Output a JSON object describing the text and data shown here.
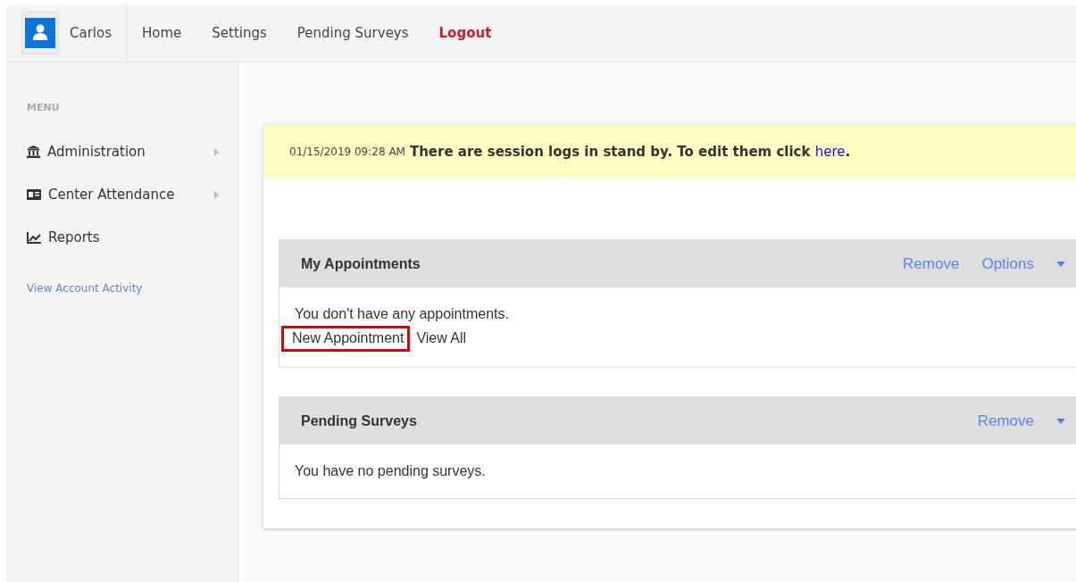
{
  "user": {
    "name": "Carlos"
  },
  "nav": [
    {
      "label": "Home",
      "kind": "link"
    },
    {
      "label": "Settings",
      "kind": "link"
    },
    {
      "label": "Pending Surveys",
      "kind": "link"
    },
    {
      "label": "Logout",
      "kind": "logout"
    }
  ],
  "sidebar": {
    "heading": "MENU",
    "items": [
      {
        "label": "Administration",
        "kind": "bank",
        "submenu": true
      },
      {
        "label": "Center Attendance",
        "kind": "card",
        "submenu": true
      },
      {
        "label": "Reports",
        "kind": "chart",
        "submenu": false
      }
    ],
    "footer_link": "View Account Activity"
  },
  "alert": {
    "timestamp": "01/15/2019 09:28 AM",
    "message": "There are session logs in stand by. To edit them click",
    "link": "here",
    "trailing": "."
  },
  "panels": [
    {
      "title": "My Appointments",
      "actions": [
        "Remove",
        "Options"
      ],
      "menu_caret": true,
      "message": "You don't have any appointments.",
      "links": [
        {
          "label": "New Appointment",
          "highlighted": true
        },
        {
          "label": "View All",
          "highlighted": false
        }
      ]
    },
    {
      "title": "Pending Surveys",
      "actions": [
        "Remove"
      ],
      "menu_caret": true,
      "message": "You have no pending surveys."
    }
  ]
}
